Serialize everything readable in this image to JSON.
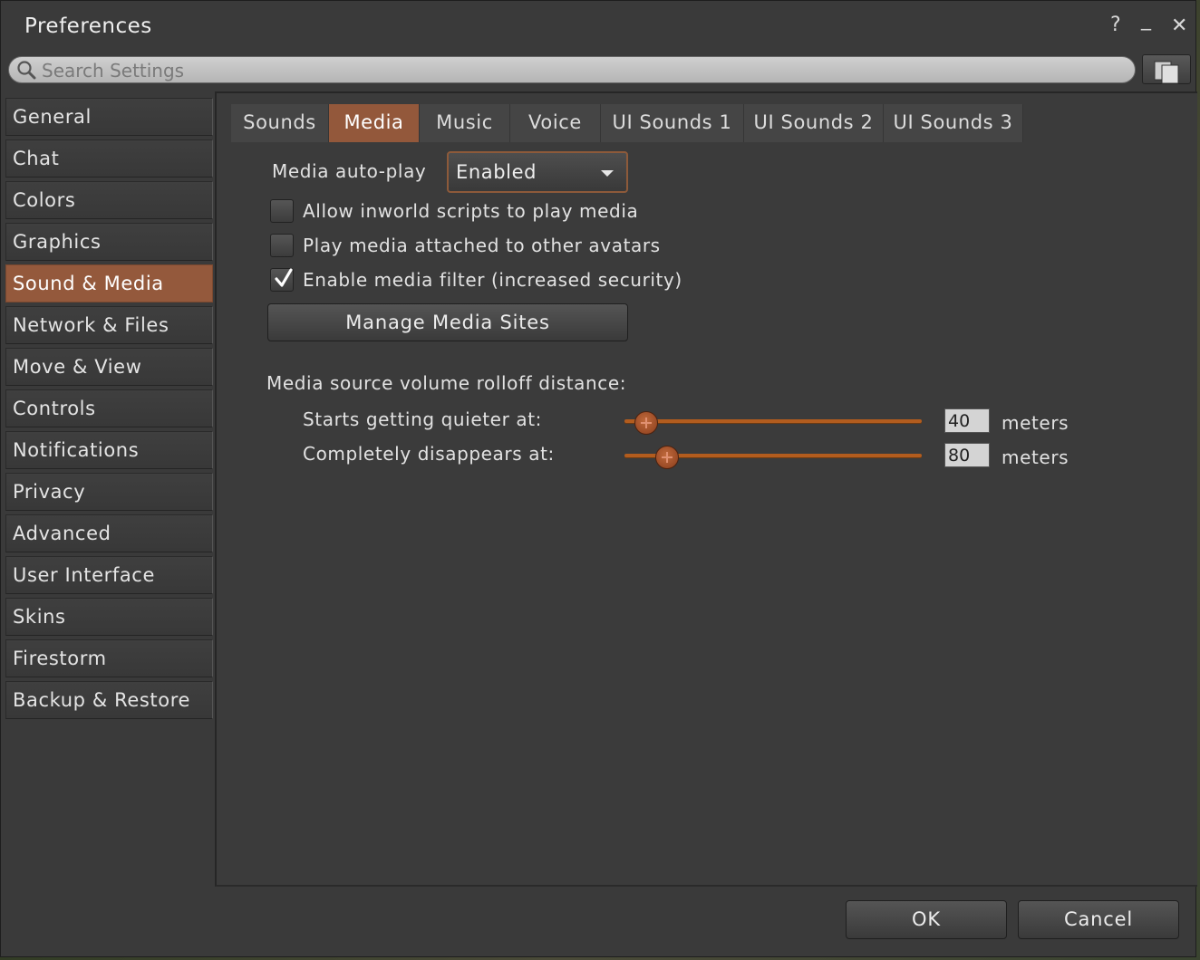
{
  "window": {
    "title": "Preferences",
    "help": "?",
    "minimize": "_",
    "close": "✕"
  },
  "search": {
    "placeholder": "Search Settings",
    "value": ""
  },
  "sidebar": {
    "items": [
      {
        "label": "General"
      },
      {
        "label": "Chat"
      },
      {
        "label": "Colors"
      },
      {
        "label": "Graphics"
      },
      {
        "label": "Sound & Media",
        "active": true
      },
      {
        "label": "Network & Files"
      },
      {
        "label": "Move & View"
      },
      {
        "label": "Controls"
      },
      {
        "label": "Notifications"
      },
      {
        "label": "Privacy"
      },
      {
        "label": "Advanced"
      },
      {
        "label": "User Interface"
      },
      {
        "label": "Skins"
      },
      {
        "label": "Firestorm"
      },
      {
        "label": "Backup & Restore"
      }
    ]
  },
  "tabs": [
    {
      "label": "Sounds"
    },
    {
      "label": "Media",
      "active": true
    },
    {
      "label": "Music"
    },
    {
      "label": "Voice"
    },
    {
      "label": "UI Sounds 1"
    },
    {
      "label": "UI Sounds 2"
    },
    {
      "label": "UI Sounds 3"
    }
  ],
  "media": {
    "autoplay_label": "Media auto-play",
    "autoplay_value": "Enabled",
    "allow_scripts_label": "Allow inworld scripts to play media",
    "allow_scripts_checked": false,
    "attached_label": "Play media attached to other avatars",
    "attached_checked": false,
    "filter_label": "Enable media filter (increased security)",
    "filter_checked": true,
    "manage_button": "Manage Media Sites",
    "rolloff_heading": "Media source volume rolloff distance:",
    "quieter_label": "Starts getting quieter at:",
    "quieter_value": "40",
    "quieter_fraction": 0.07,
    "disappear_label": "Completely disappears at:",
    "disappear_value": "80",
    "disappear_fraction": 0.14,
    "unit": "meters"
  },
  "footer": {
    "ok": "OK",
    "cancel": "Cancel"
  },
  "colors": {
    "accent": "#94593c",
    "slider": "#b25c1e"
  }
}
